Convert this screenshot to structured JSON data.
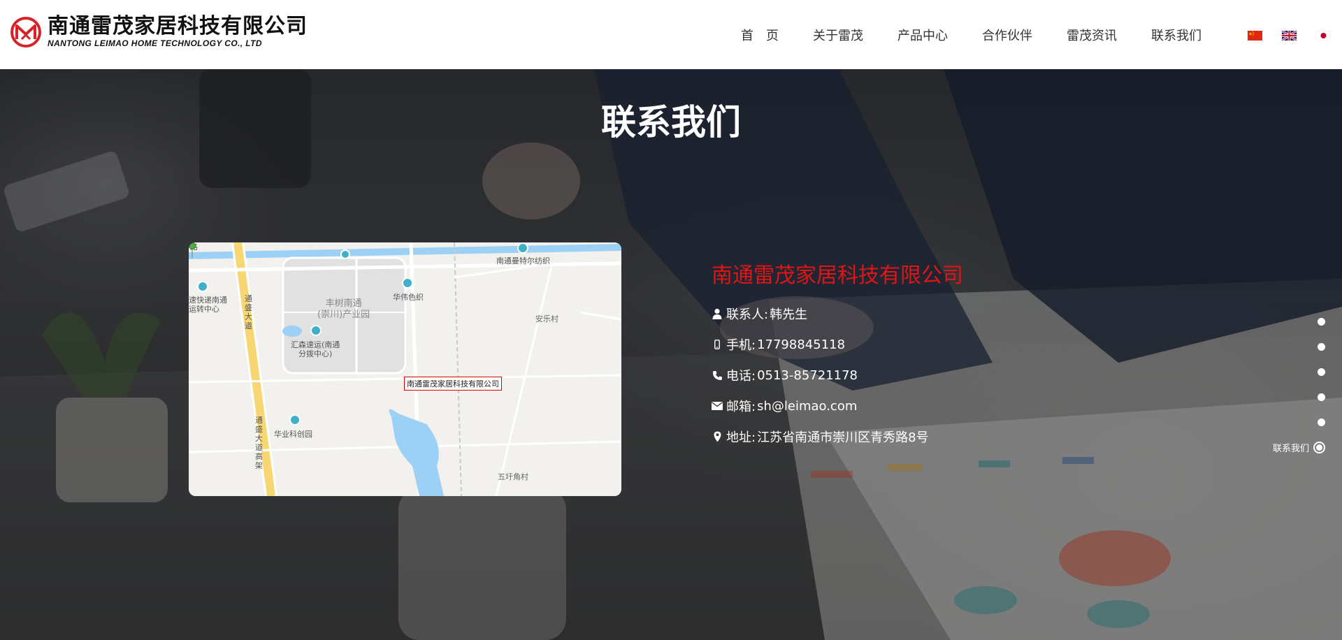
{
  "header": {
    "logo_cn": "南通雷茂家居科技有限公司",
    "logo_en": "NANTONG LEIMAO HOME TECHNOLOGY CO., LTD",
    "brand_color": "#d7222a",
    "nav": [
      {
        "label": "首　页"
      },
      {
        "label": "关于雷茂"
      },
      {
        "label": "产品中心"
      },
      {
        "label": "合作伙伴"
      },
      {
        "label": "雷茂资讯"
      },
      {
        "label": "联系我们"
      }
    ],
    "flags": [
      {
        "icon": "flag-cn-icon"
      },
      {
        "icon": "flag-uk-icon"
      },
      {
        "icon": "flag-jp-icon"
      }
    ]
  },
  "hero": {
    "title": "联系我们"
  },
  "map": {
    "labels": {
      "road_top": "路",
      "express": "速快递南通\n运转中心",
      "tongsheng": "通\n盛\n大\n道",
      "park": "丰树南通\n(崇川)产业园",
      "huisen": "汇森速运(南通\n分拨中心)",
      "huawei": "华伟色织",
      "mantel": "南通曼特尔纺织",
      "anle": "安乐村",
      "tongsheng_high": "通\n盛\n大\n道\n高\n架",
      "huaye": "华业科创园",
      "wuwei": "五圩角村"
    },
    "marker_label": "南通雷茂家居科技有限公司"
  },
  "contact": {
    "company": "南通雷茂家居科技有限公司",
    "company_color": "#e01515",
    "rows": [
      {
        "icon": "user-icon",
        "label": "联系人:",
        "value": "韩先生"
      },
      {
        "icon": "mobile-icon",
        "label": "手机:",
        "value": "17798845118"
      },
      {
        "icon": "phone-icon",
        "label": "电话:",
        "value": "0513-85721178"
      },
      {
        "icon": "envelope-icon",
        "label": "邮箱:",
        "value": "sh@leimao.com"
      },
      {
        "icon": "location-icon",
        "label": "地址:",
        "value": "江苏省南通市崇川区青秀路8号"
      }
    ]
  },
  "side_nav": {
    "active_label": "联系我们"
  }
}
